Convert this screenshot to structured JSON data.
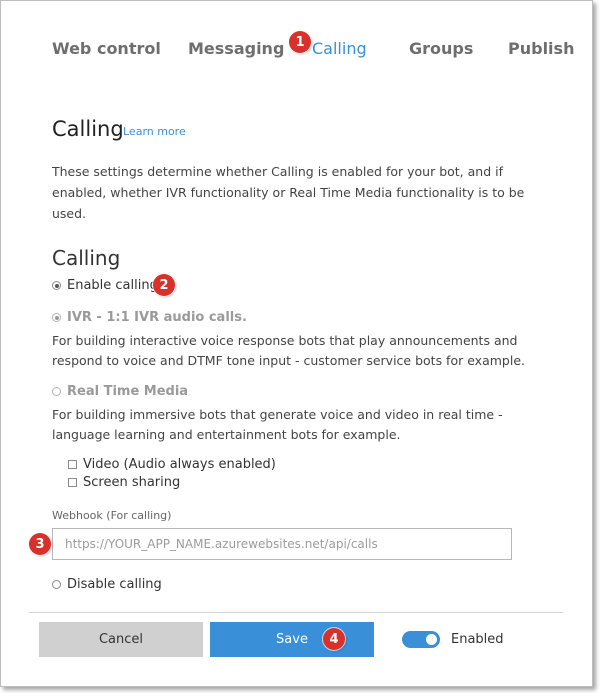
{
  "tabs": [
    {
      "label": "Web control",
      "active": false
    },
    {
      "label": "Messaging",
      "active": false
    },
    {
      "label": "Calling",
      "active": true
    },
    {
      "label": "Groups",
      "active": false
    },
    {
      "label": "Publish",
      "active": false
    }
  ],
  "annotations": [
    "1",
    "2",
    "3",
    "4"
  ],
  "header": {
    "title": "Calling",
    "learn_more": "Learn more",
    "description": "These settings determine whether Calling is enabled for your bot, and if enabled, whether IVR functionality or Real Time Media functionality is to be used."
  },
  "calling": {
    "section_title": "Calling",
    "enable_label": "Enable calling",
    "enable_selected": true,
    "ivr_label": "IVR - 1:1 IVR audio calls.",
    "ivr_selected": true,
    "ivr_help": "For building interactive voice response bots that play announcements and respond to voice and DTMF tone input - customer service bots for example.",
    "rtm_label": "Real Time Media",
    "rtm_selected": false,
    "rtm_help": "For building immersive bots that generate voice and video in real time - language learning and entertainment bots for example.",
    "video_label": "Video (Audio always enabled)",
    "video_checked": false,
    "screen_label": "Screen sharing",
    "screen_checked": false,
    "webhook_label": "Webhook (For calling)",
    "webhook_placeholder": "https://YOUR_APP_NAME.azurewebsites.net/api/calls",
    "webhook_value": "",
    "disable_label": "Disable calling",
    "disable_selected": false
  },
  "footer": {
    "cancel_label": "Cancel",
    "save_label": "Save",
    "enabled_label": "Enabled",
    "enabled_on": true
  },
  "colors": {
    "accent": "#3a8fd9",
    "annotation_badge": "#d8302a",
    "cancel_bg": "#d0d0d0"
  }
}
